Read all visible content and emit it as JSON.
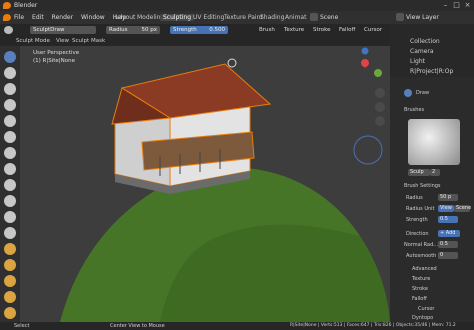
{
  "app": {
    "title": "Blender"
  },
  "window_controls": {
    "minimize": "–",
    "maximize": "□",
    "close": "×"
  },
  "menu": [
    "File",
    "Edit",
    "Render",
    "Window",
    "Help"
  ],
  "workspace_tabs": [
    "Layout",
    "Modeling",
    "Sculpting",
    "UV Editing",
    "Texture Paint",
    "Shading",
    "Animat"
  ],
  "active_workspace": "Sculpting",
  "scene": {
    "label": "Scene",
    "view_layer": "View Layer"
  },
  "tool_header": {
    "brush_name": "SculptDraw",
    "radius_label": "Radius",
    "radius_value": "50 px",
    "strength_label": "Strength",
    "strength_value": "0.500",
    "menus": [
      "Brush",
      "Texture",
      "Stroke",
      "Falloff",
      "Cursor"
    ]
  },
  "mode_header": {
    "mode": "Sculpt Mode",
    "items": [
      "View",
      "Sculpt",
      "Mask"
    ]
  },
  "viewport": {
    "perspective": "User Perspective",
    "object": "(1) R|Site|None"
  },
  "outliner": {
    "items": [
      "Collection",
      "Camera",
      "Light",
      "R|Project|R:Op"
    ]
  },
  "properties": {
    "tool_name": "Draw",
    "brushes_label": "Brushes",
    "brush_field": "Sculp",
    "brush_count": "2",
    "brush_settings_label": "Brush Settings",
    "radius_label": "Radius",
    "radius_value": "50 p",
    "radius_unit_label": "Radius Unit",
    "radius_unit_view": "View",
    "radius_unit_scene": "Scene",
    "strength_label": "Strength",
    "strength_value": "0.5",
    "direction_label": "Direction",
    "direction_add": "+ Add",
    "normal_radius_label": "Normal Rad...",
    "normal_radius_value": "0.5",
    "autosmooth_label": "Autosmooth",
    "autosmooth_value": "0",
    "subpanels": [
      "Advanced",
      "Texture",
      "Stroke",
      "Falloff",
      "Cursor"
    ],
    "dyntopo_label": "Dyntopo"
  },
  "status_bar": {
    "select": "Select",
    "center": "Center View to Mouse",
    "stats": "R|Site|None | Verts:513 | Faces:647 | Tris:826 | Objects:35/46 | Mem: 71.2"
  },
  "colors": {
    "accent_blue": "#4772b3",
    "selection_orange": "#e87d0d",
    "hill_green": "#3f6a22",
    "roof": "#8b3a24"
  }
}
